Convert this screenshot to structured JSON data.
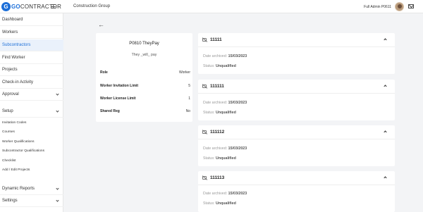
{
  "header": {
    "logo_mark": "G",
    "logo_brand": "GO",
    "logo_rest": "CONTRACTOR",
    "org_name": "Construction Group",
    "user_name": "Full Admin P0611"
  },
  "sidebar": {
    "items": [
      {
        "label": "Dashboard"
      },
      {
        "label": "Workers"
      },
      {
        "label": "Subcontractors"
      },
      {
        "label": "Find Worker"
      },
      {
        "label": "Projects"
      },
      {
        "label": "Check-in Activity"
      },
      {
        "label": "Approval"
      },
      {
        "label": "Setup"
      }
    ],
    "setup_sub": [
      {
        "label": "Invitation Codes"
      },
      {
        "label": "Courses"
      },
      {
        "label": "Worker Qualifications"
      },
      {
        "label": "Subcontractor Qualifications"
      },
      {
        "label": "Checklist"
      },
      {
        "label": "Add / Edit Projects"
      }
    ],
    "bottom": [
      {
        "label": "Dynamic Reports"
      },
      {
        "label": "Settings"
      }
    ]
  },
  "profile": {
    "back_glyph": "←",
    "title": "P0810 TheyPay",
    "subtitle": "They _will_ pay",
    "rows": [
      {
        "key": "Role",
        "value": "Worker"
      },
      {
        "key": "Worker Invitation Limit",
        "value": "5"
      },
      {
        "key": "Worker License Limit",
        "value": "1"
      },
      {
        "key": "Shared Reg",
        "value": "No"
      }
    ]
  },
  "archives": [
    {
      "title": "11111",
      "archived_label": "Date archived:",
      "archived_value": "15/03/2023",
      "status_label": "Status:",
      "status_value": "Unqualified"
    },
    {
      "title": "111111",
      "archived_label": "Date archived:",
      "archived_value": "15/03/2023",
      "status_label": "Status:",
      "status_value": "Unqualified"
    },
    {
      "title": "111112",
      "archived_label": "Date archived:",
      "archived_value": "15/03/2023",
      "status_label": "Status:",
      "status_value": "Unqualified"
    },
    {
      "title": "111113",
      "archived_label": "Date archived:",
      "archived_value": "15/03/2023",
      "status_label": "Status:",
      "status_value": "Unqualified"
    }
  ],
  "colors": {
    "accent": "#1d6fd8",
    "active_bg": "#eaf1fb",
    "page_bg": "#f3f4f6"
  }
}
